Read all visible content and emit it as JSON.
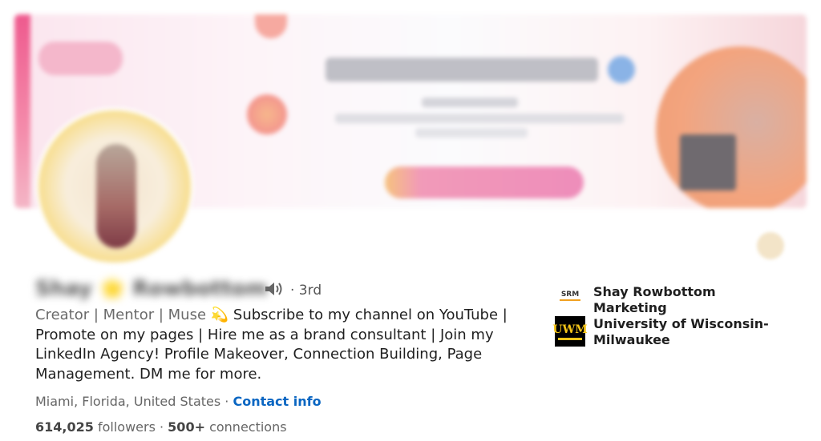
{
  "profile": {
    "name": "Shay 🌟 Rowbottom",
    "degree": "· 3rd",
    "headline_part1": "Creator | Mentor | Muse ",
    "headline_emoji": "💫",
    "headline_part2": " Subscribe to my channel on YouTube | Promote on my pages | Hire me as a brand consultant | Join my LinkedIn Agency! Profile Makeover, Connection Building, Page Management. DM me for more.",
    "location": "Miami, Florida, United States",
    "location_sep": " · ",
    "contact_info": "Contact info",
    "followers_count": "614,025",
    "followers_label": " followers",
    "stats_sep": " · ",
    "connections_count": "500+",
    "connections_label": " connections"
  },
  "affiliations": [
    {
      "name": "Shay Rowbottom Marketing",
      "logo_text": "SRM"
    },
    {
      "name": "University of Wisconsin-Milwaukee",
      "logo_text": "UWM"
    }
  ],
  "colors": {
    "link": "#0a66c2",
    "text": "#1f1f1f",
    "muted": "#666666"
  },
  "icons": {
    "pronunciation": "speaker-icon"
  }
}
